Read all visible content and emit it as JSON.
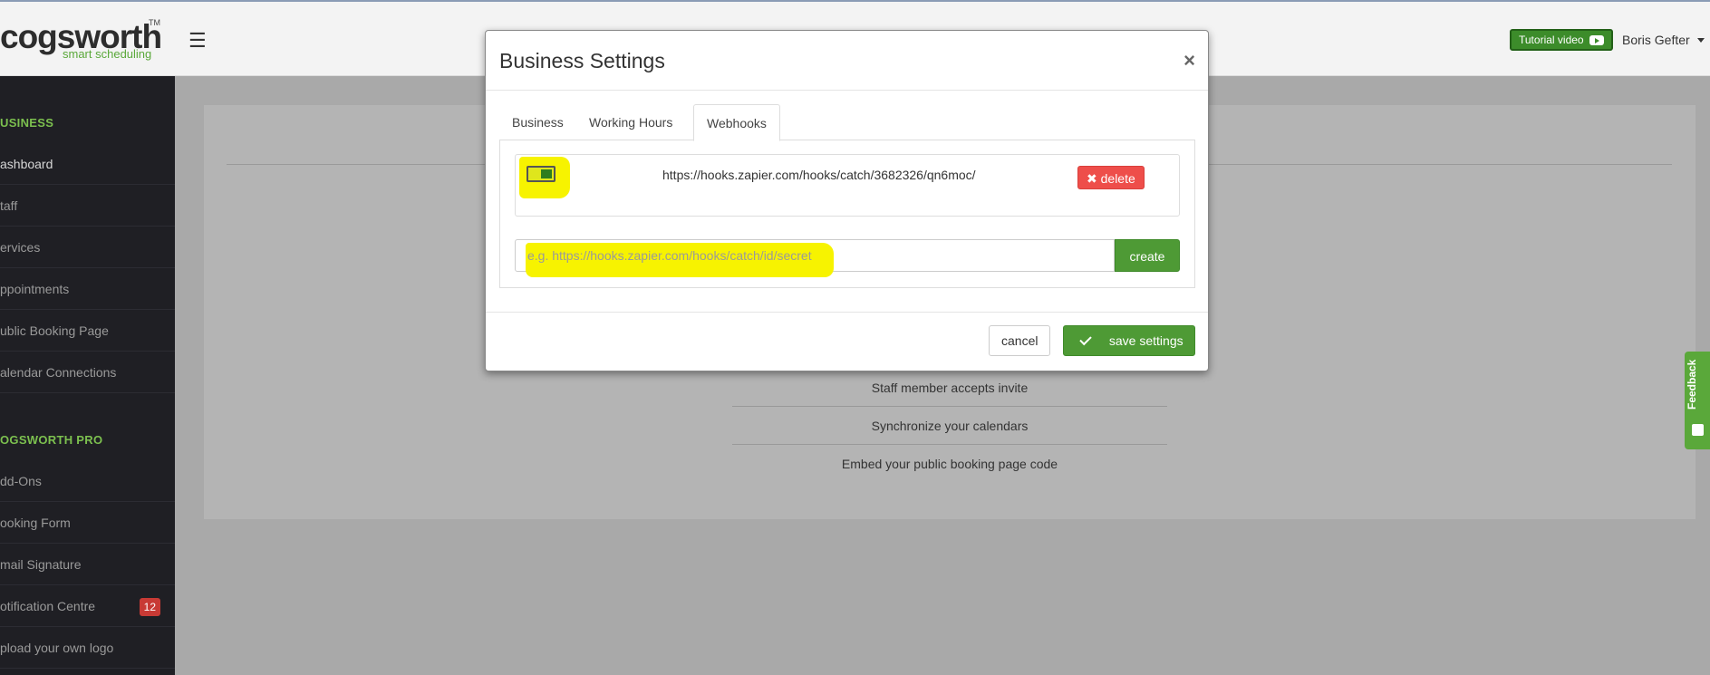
{
  "header": {
    "logo_text": "cogsworth",
    "logo_tm": "TM",
    "logo_tagline": "smart scheduling",
    "menu_icon": "☰",
    "tutorial_label": "Tutorial video",
    "user_name": "Boris Gefter"
  },
  "sidebar": {
    "section1": "USINESS",
    "items1": [
      {
        "label": "ashboard"
      },
      {
        "label": "taff"
      },
      {
        "label": "ervices"
      },
      {
        "label": "ppointments"
      },
      {
        "label": "ublic Booking Page"
      },
      {
        "label": "alendar Connections"
      }
    ],
    "section2": "OGSWORTH PRO",
    "items2": [
      {
        "label": "dd-Ons"
      },
      {
        "label": "ooking Form"
      },
      {
        "label": "mail Signature"
      },
      {
        "label": "otification Centre",
        "badge": "12"
      },
      {
        "label": "pload your own logo"
      }
    ]
  },
  "background": {
    "steps": [
      "Staff member accepts invite",
      "Synchronize your calendars",
      "Embed your public booking page code"
    ]
  },
  "feedback": {
    "label": "Feedback"
  },
  "modal": {
    "title": "Business Settings",
    "close": "×",
    "tabs": [
      "Business",
      "Working Hours",
      "Webhooks"
    ],
    "active_tab": "Webhooks",
    "webhook": {
      "url": "https://hooks.zapier.com/hooks/catch/3682326/qn6moc/",
      "enabled": true,
      "delete_label": "delete"
    },
    "new_webhook": {
      "placeholder": "e.g. https://hooks.zapier.com/hooks/catch/id/secret",
      "create_label": "create"
    },
    "footer": {
      "cancel_label": "cancel",
      "save_label": "save settings"
    }
  },
  "colors": {
    "brand_green": "#5aa83a",
    "danger": "#ee4e4a",
    "highlight": "#f7f300",
    "sidebar_bg": "#1f1f24"
  }
}
